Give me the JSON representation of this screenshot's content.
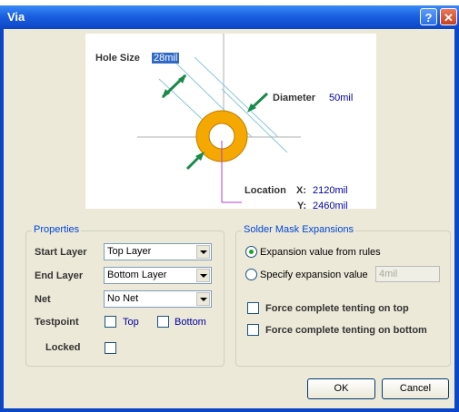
{
  "window": {
    "title": "Via",
    "help_glyph": "?",
    "close_glyph": "✕"
  },
  "diagram": {
    "hole_size_label": "Hole Size",
    "hole_size_value": "28mil",
    "diameter_label": "Diameter",
    "diameter_value": "50mil",
    "location_label": "Location",
    "x_label": "X:",
    "x_value": "2120mil",
    "y_label": "Y:",
    "y_value": "2460mil",
    "colors": {
      "pad": "#f5a800",
      "pad_edge": "#c27a00",
      "arrow": "#1a8a4a",
      "guide": "#88c8d8",
      "crosshair": "#b0b0b0",
      "origin": "#b040d0"
    }
  },
  "properties": {
    "title": "Properties",
    "start_layer_label": "Start Layer",
    "start_layer_value": "Top Layer",
    "end_layer_label": "End Layer",
    "end_layer_value": "Bottom Layer",
    "net_label": "Net",
    "net_value": "No Net",
    "testpoint_label": "Testpoint",
    "top_label": "Top",
    "bottom_label": "Bottom",
    "locked_label": "Locked"
  },
  "solder_mask": {
    "title": "Solder Mask Expansions",
    "rules_label": "Expansion value from rules",
    "specify_label": "Specify expansion value",
    "specify_value": "4mil",
    "tent_top_label": "Force complete tenting on top",
    "tent_bottom_label": "Force complete tenting on bottom"
  },
  "buttons": {
    "ok": "OK",
    "cancel": "Cancel"
  }
}
